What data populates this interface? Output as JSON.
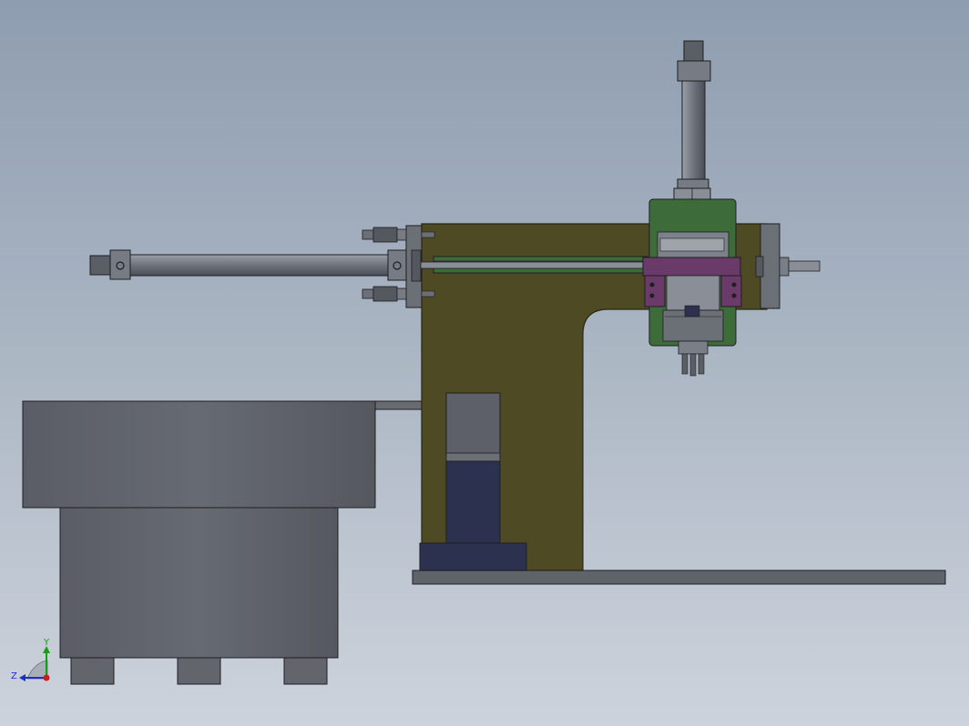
{
  "view": {
    "background_top": "#8e9db0",
    "background_bottom": "#cdd3dc"
  },
  "colors": {
    "frame": "#4d4a24",
    "frame_edge": "#2a2812",
    "steel": "#6b6f76",
    "steel_dark": "#45484d",
    "steel_light": "#9ea3aa",
    "bowl": "#5d6068",
    "motor_base": "#2c3150",
    "green_plate": "#3e6b3a",
    "purple_block": "#6a3a68",
    "outline": "#1e1f22"
  },
  "triad": {
    "y_label": "Y",
    "z_label": "Z",
    "y_color": "#1a9a1a",
    "x_color": "#c81e1e",
    "z_color": "#1e2ec8"
  }
}
